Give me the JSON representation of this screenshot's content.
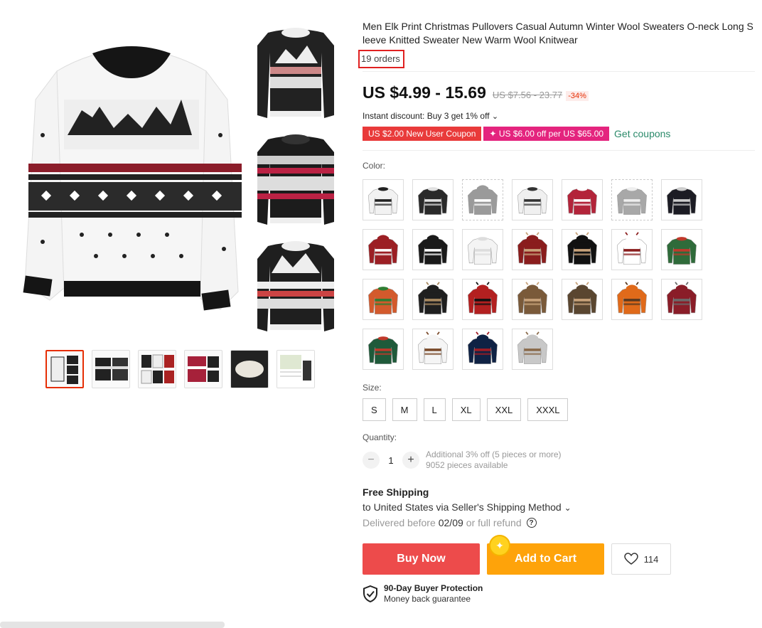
{
  "product": {
    "title": "Men Elk Print Christmas Pullovers Casual Autumn Winter Wool Sweaters O-neck Long Sleeve Knitted Sweater New Warm Wool Knitwear",
    "orders": "19 orders",
    "price": "US $4.99 - 15.69",
    "original_price": "US $7.56 - 23.77",
    "discount_pct": "-34%",
    "instant_discount": "Instant discount: Buy 3 get 1% off",
    "coupon_1": "US $2.00 New User Coupon",
    "coupon_2": "US $6.00 off per US $65.00",
    "coupon_2_prefix": "✦",
    "get_coupons": "Get coupons"
  },
  "color": {
    "label": "Color:",
    "swatches": [
      {
        "body": "#f2f2f2",
        "accent": "#222222",
        "hood": false
      },
      {
        "body": "#2a2a2a",
        "accent": "#e0e0e0",
        "hood": false
      },
      {
        "body": "#9a9a9a",
        "accent": "#ffffff",
        "hood": true
      },
      {
        "body": "#f0f0f0",
        "accent": "#333333",
        "hood": false
      },
      {
        "body": "#b3243a",
        "accent": "#ffffff",
        "hood": false
      },
      {
        "body": "#a8a8a8",
        "accent": "#eeeeee",
        "hood": false
      },
      {
        "body": "#1c1c24",
        "accent": "#cccccc",
        "hood": false
      },
      {
        "body": "#9c1f24",
        "accent": "#ffffff",
        "hood": true
      },
      {
        "body": "#1a1a1a",
        "accent": "#ffffff",
        "hood": true
      },
      {
        "body": "#f4f4f4",
        "accent": "#dddddd",
        "hood": false
      },
      {
        "body": "#8a1d1d",
        "accent": "#c8a27a",
        "hood": true
      },
      {
        "body": "#111111",
        "accent": "#c8a27a",
        "hood": true
      },
      {
        "body": "#ffffff",
        "accent": "#8a1d1d",
        "hood": true
      },
      {
        "body": "#2f6b3a",
        "accent": "#c0392b",
        "hood": false
      },
      {
        "body": "#d35a2c",
        "accent": "#2e7d32",
        "hood": false
      },
      {
        "body": "#1f1f1f",
        "accent": "#a88960",
        "hood": true
      },
      {
        "body": "#b32020",
        "accent": "#111111",
        "hood": true
      },
      {
        "body": "#7a5a3a",
        "accent": "#c8a27a",
        "hood": true
      },
      {
        "body": "#5a4630",
        "accent": "#c8a27a",
        "hood": true
      },
      {
        "body": "#e06a1a",
        "accent": "#5a3a20",
        "hood": true
      },
      {
        "body": "#8a1d28",
        "accent": "#6a6a6a",
        "hood": true
      },
      {
        "body": "#1f5a3a",
        "accent": "#c0392b",
        "hood": false
      },
      {
        "body": "#f5f5f5",
        "accent": "#7a4a2a",
        "hood": true
      },
      {
        "body": "#0f2244",
        "accent": "#a01c24",
        "hood": true
      },
      {
        "body": "#c8c8c8",
        "accent": "#8a6a4a",
        "hood": true
      }
    ]
  },
  "size": {
    "label": "Size:",
    "options": [
      "S",
      "M",
      "L",
      "XL",
      "XXL",
      "XXXL"
    ]
  },
  "quantity": {
    "label": "Quantity:",
    "minus": "−",
    "value": "1",
    "plus": "+",
    "bulk_note": "Additional 3% off (5 pieces or more)",
    "available": "9052 pieces available"
  },
  "shipping": {
    "title": "Free Shipping",
    "method": "to United States via Seller's Shipping Method",
    "delivered_prefix": "Delivered before",
    "delivered_date": "02/09",
    "delivered_suffix": "or full refund",
    "help_icon": "?"
  },
  "actions": {
    "buy_now": "Buy Now",
    "add_to_cart": "Add to Cart",
    "wishlist_count": "114",
    "coin_icon": "✦"
  },
  "protection": {
    "title": "90-Day Buyer Protection",
    "subtitle": "Money back guarantee"
  },
  "icons": {
    "chevron": "⌄"
  }
}
